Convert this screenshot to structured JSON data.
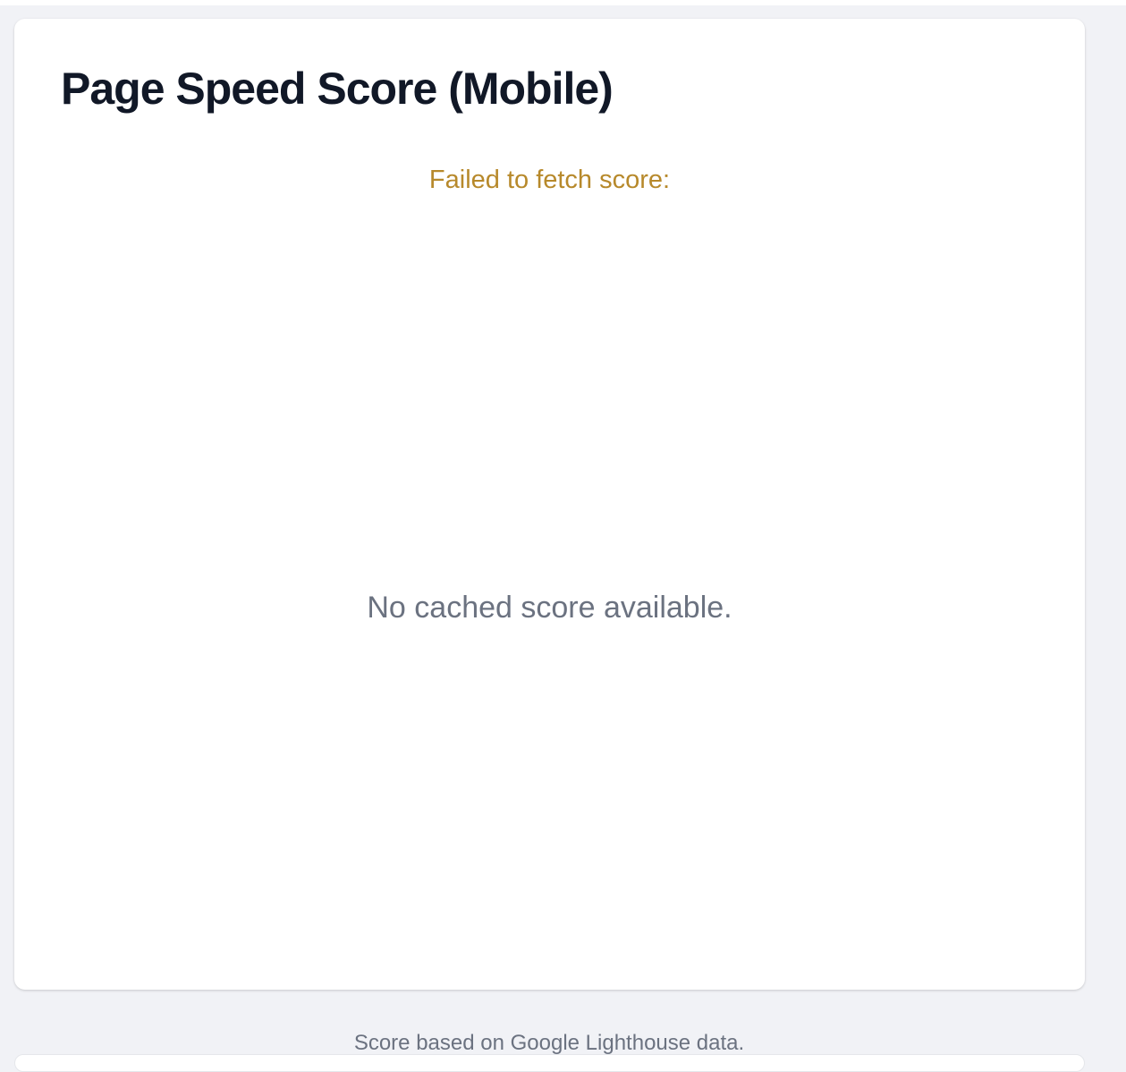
{
  "card": {
    "title": "Page Speed Score (Mobile)",
    "error_message": "Failed to fetch score:",
    "empty_message": "No cached score available."
  },
  "footer": {
    "note": "Score based on Google Lighthouse data."
  },
  "colors": {
    "page_background": "#f1f2f6",
    "card_background": "#ffffff",
    "title": "#111827",
    "warning": "#b7892b",
    "muted": "#6b7280"
  }
}
